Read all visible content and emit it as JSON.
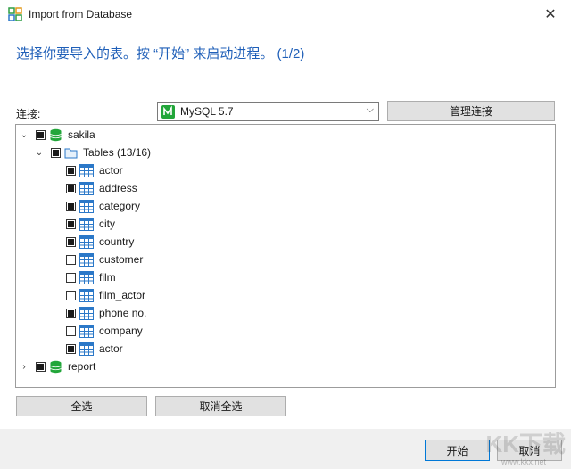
{
  "window": {
    "title": "Import from Database",
    "close_glyph": "✕"
  },
  "instruction": "选择你要导入的表。按 “开始” 来启动进程。 (1/2)",
  "connection": {
    "label": "连接:",
    "selected": "MySQL 5.7",
    "manage_label": "管理连接"
  },
  "tree": {
    "root": {
      "label": "sakila",
      "checked": true,
      "expanded": true
    },
    "folder": {
      "label": "Tables (13/16)",
      "checked": true,
      "expanded": true
    },
    "tables": [
      {
        "label": "actor",
        "checked": true
      },
      {
        "label": "address",
        "checked": true
      },
      {
        "label": "category",
        "checked": true
      },
      {
        "label": "city",
        "checked": true
      },
      {
        "label": "country",
        "checked": true
      },
      {
        "label": "customer",
        "checked": false
      },
      {
        "label": "film",
        "checked": false
      },
      {
        "label": "film_actor",
        "checked": false
      },
      {
        "label": "phone no.",
        "checked": true
      },
      {
        "label": "company",
        "checked": false
      },
      {
        "label": "actor",
        "checked": true
      }
    ],
    "second_root": {
      "label": "report",
      "checked": true,
      "expanded": false
    }
  },
  "buttons": {
    "select_all": "全选",
    "deselect_all": "取消全选",
    "start": "开始",
    "cancel": "取消"
  },
  "watermark": {
    "text": "KK下载",
    "url": "www.kkx.net"
  },
  "colors": {
    "instruction": "#1f5fb8",
    "db_icon": "#22a63a",
    "table_icon": "#2b78c8",
    "primary_border": "#0078d7"
  }
}
